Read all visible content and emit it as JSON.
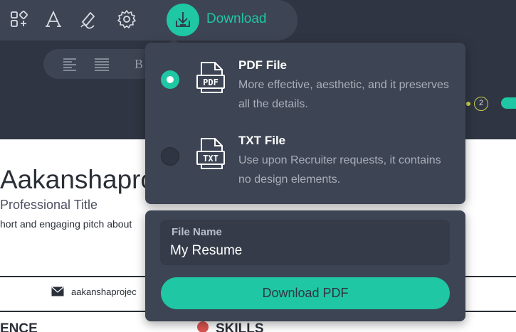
{
  "toolbar": {
    "icons": [
      "layout-add-icon",
      "font-icon",
      "pen-icon",
      "gear-icon",
      "download-icon"
    ],
    "download_label": "Download",
    "accent_color": "#1fc7a4"
  },
  "format_bar": {
    "bold_label": "B"
  },
  "pager": {
    "page": "2"
  },
  "resume": {
    "name": "Aakanshapro",
    "title": "Professional Title",
    "pitch": "hort and engaging pitch about",
    "email": "aakanshaprojec",
    "section_left": "ENCE",
    "section_right": "SKILLS"
  },
  "download_menu": {
    "options": [
      {
        "title": "PDF File",
        "icon_text": "PDF",
        "description": "More effective, aesthetic, and it preserves all the details.",
        "selected": true
      },
      {
        "title": "TXT File",
        "icon_text": "TXT",
        "description": "Use upon Recruiter requests, it contains no design elements.",
        "selected": false
      }
    ],
    "file_name_label": "File Name",
    "file_name_value": "My Resume",
    "button_label": "Download PDF"
  }
}
